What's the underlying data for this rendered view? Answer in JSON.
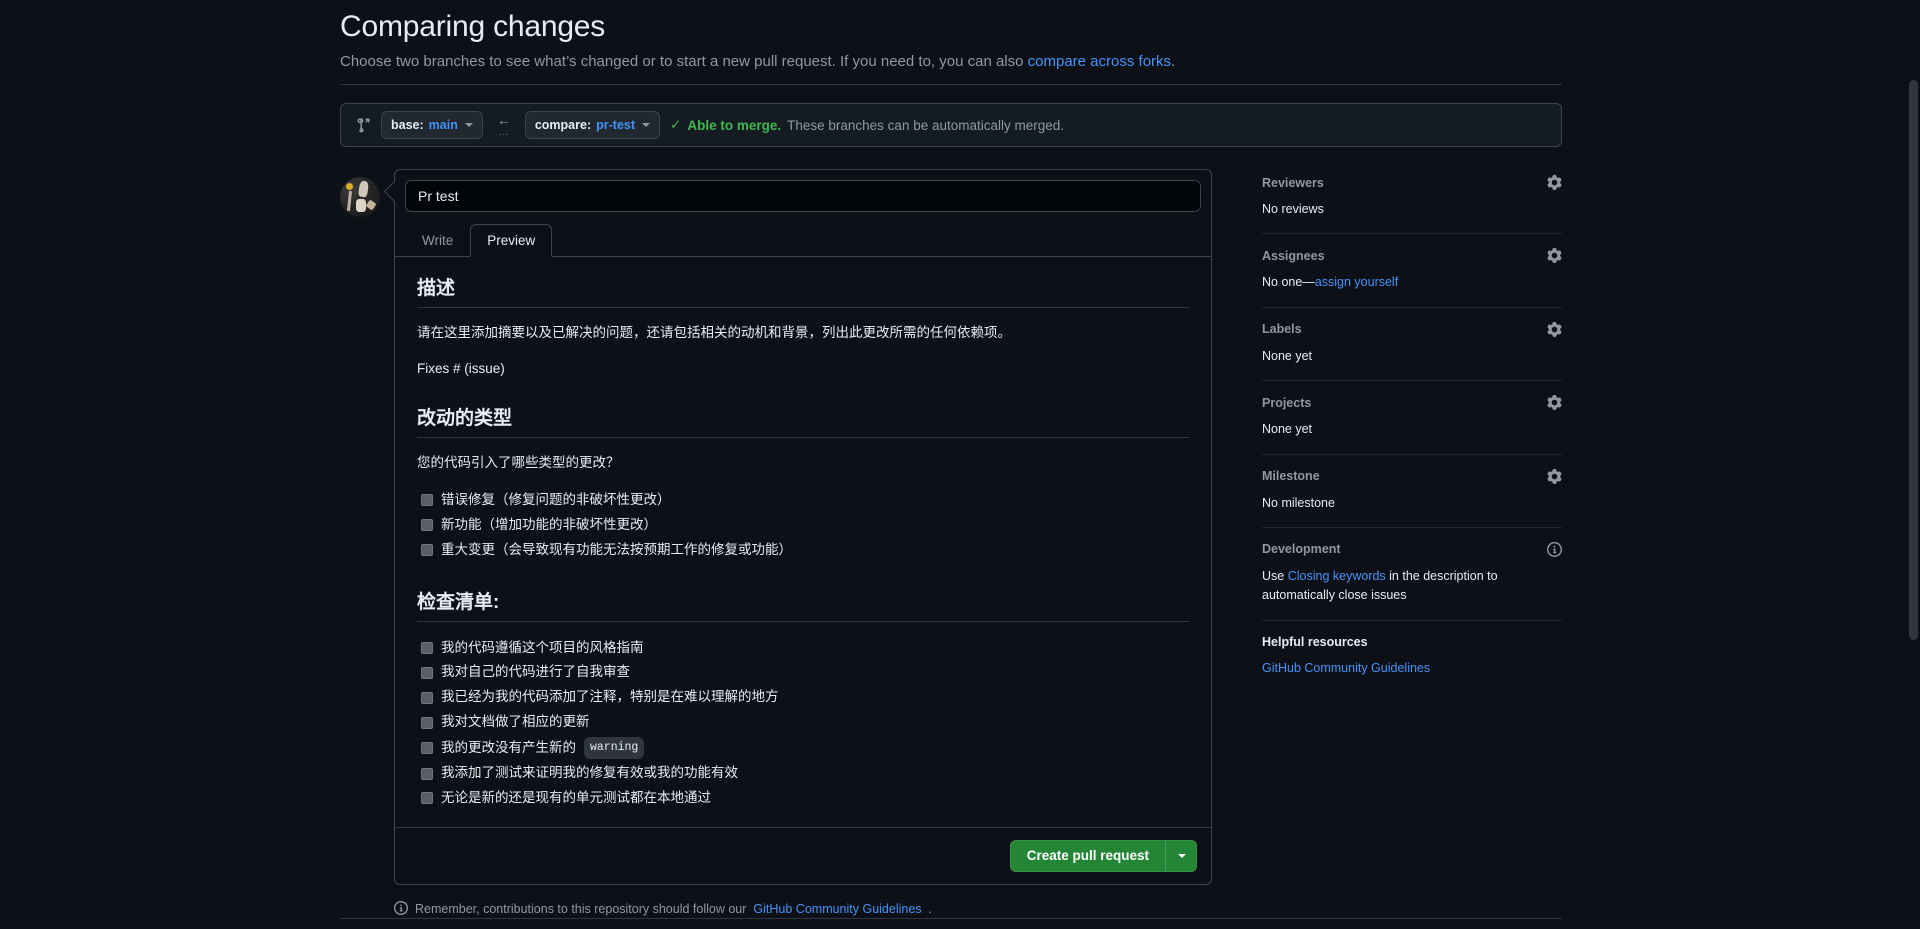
{
  "header": {
    "title": "Comparing changes",
    "subtitle_prefix": "Choose two branches to see what’s changed or to start a new pull request. If you need to, you can also ",
    "subtitle_link": "compare across forks",
    "subtitle_suffix": "."
  },
  "compare_bar": {
    "compare_icon": "git-compare-icon",
    "base_label": "base:",
    "base_branch": "main",
    "arrow_icon": "arrow-left-icon",
    "arrow_dots": "...",
    "compare_label": "compare:",
    "compare_branch": "pr-test",
    "check_icon": "check-icon",
    "status_strong": "Able to merge.",
    "status_rest": " These branches can be automatically merged."
  },
  "pull_request": {
    "title_value": "Pr test",
    "title_placeholder": "Title",
    "tabs": [
      {
        "label": "Write",
        "active": false
      },
      {
        "label": "Preview",
        "active": true
      }
    ],
    "submit_label": "Create pull request",
    "submit_caret_icon": "chevron-down-icon"
  },
  "preview": {
    "section_description": {
      "heading": "描述",
      "paragraph": "请在这里添加摘要以及已解决的问题，还请包括相关的动机和背景，列出此更改所需的任何依赖项。",
      "fixes": "Fixes # (issue)"
    },
    "section_change_type": {
      "heading": "改动的类型",
      "question": "您的代码引入了哪些类型的更改？",
      "items": [
        {
          "text": "错误修复（修复问题的非破坏性更改）",
          "checked": false
        },
        {
          "text": "新功能（增加功能的非破坏性更改）",
          "checked": false
        },
        {
          "text": "重大变更（会导致现有功能无法按预期工作的修复或功能）",
          "checked": false
        }
      ]
    },
    "section_checklist": {
      "heading": "检查清单:",
      "items": [
        {
          "text": "我的代码遵循这个项目的风格指南",
          "checked": false,
          "code": null,
          "suffix": null
        },
        {
          "text": "我对自己的代码进行了自我审查",
          "checked": false,
          "code": null,
          "suffix": null
        },
        {
          "text": "我已经为我的代码添加了注释，特别是在难以理解的地方",
          "checked": false,
          "code": null,
          "suffix": null
        },
        {
          "text": "我对文档做了相应的更新",
          "checked": false,
          "code": null,
          "suffix": null
        },
        {
          "text": "我的更改没有产生新的",
          "checked": false,
          "code": "warning",
          "suffix": ""
        },
        {
          "text": "我添加了测试来证明我的修复有效或我的功能有效",
          "checked": false,
          "code": null,
          "suffix": null
        },
        {
          "text": "无论是新的还是现有的单元测试都在本地通过",
          "checked": false,
          "code": null,
          "suffix": null
        }
      ]
    }
  },
  "footer_note": {
    "icon": "info-icon",
    "text_prefix": "Remember, contributions to this repository should follow our ",
    "link": "GitHub Community Guidelines",
    "text_suffix": "."
  },
  "sidebar": {
    "sections": [
      {
        "title": "Reviewers",
        "icon": "gear-icon",
        "value": "No reviews",
        "link": null,
        "value_suffix": null
      },
      {
        "title": "Assignees",
        "icon": "gear-icon",
        "value": "No one—",
        "link": "assign yourself",
        "value_suffix": null
      },
      {
        "title": "Labels",
        "icon": "gear-icon",
        "value": "None yet",
        "link": null,
        "value_suffix": null
      },
      {
        "title": "Projects",
        "icon": "gear-icon",
        "value": "None yet",
        "link": null,
        "value_suffix": null
      },
      {
        "title": "Milestone",
        "icon": "gear-icon",
        "value": "No milestone",
        "link": null,
        "value_suffix": null
      },
      {
        "title": "Development",
        "icon": "info-icon",
        "value": "Use ",
        "link": "Closing keywords",
        "value_suffix": " in the description to automatically close issues"
      }
    ],
    "helpful": {
      "heading": "Helpful resources",
      "link": "GitHub Community Guidelines"
    }
  },
  "colors": {
    "accent_green": "#238636",
    "link_blue": "#4493f8",
    "merge_green": "#3fb950",
    "bg": "#0d1117",
    "border": "#3d444d"
  }
}
